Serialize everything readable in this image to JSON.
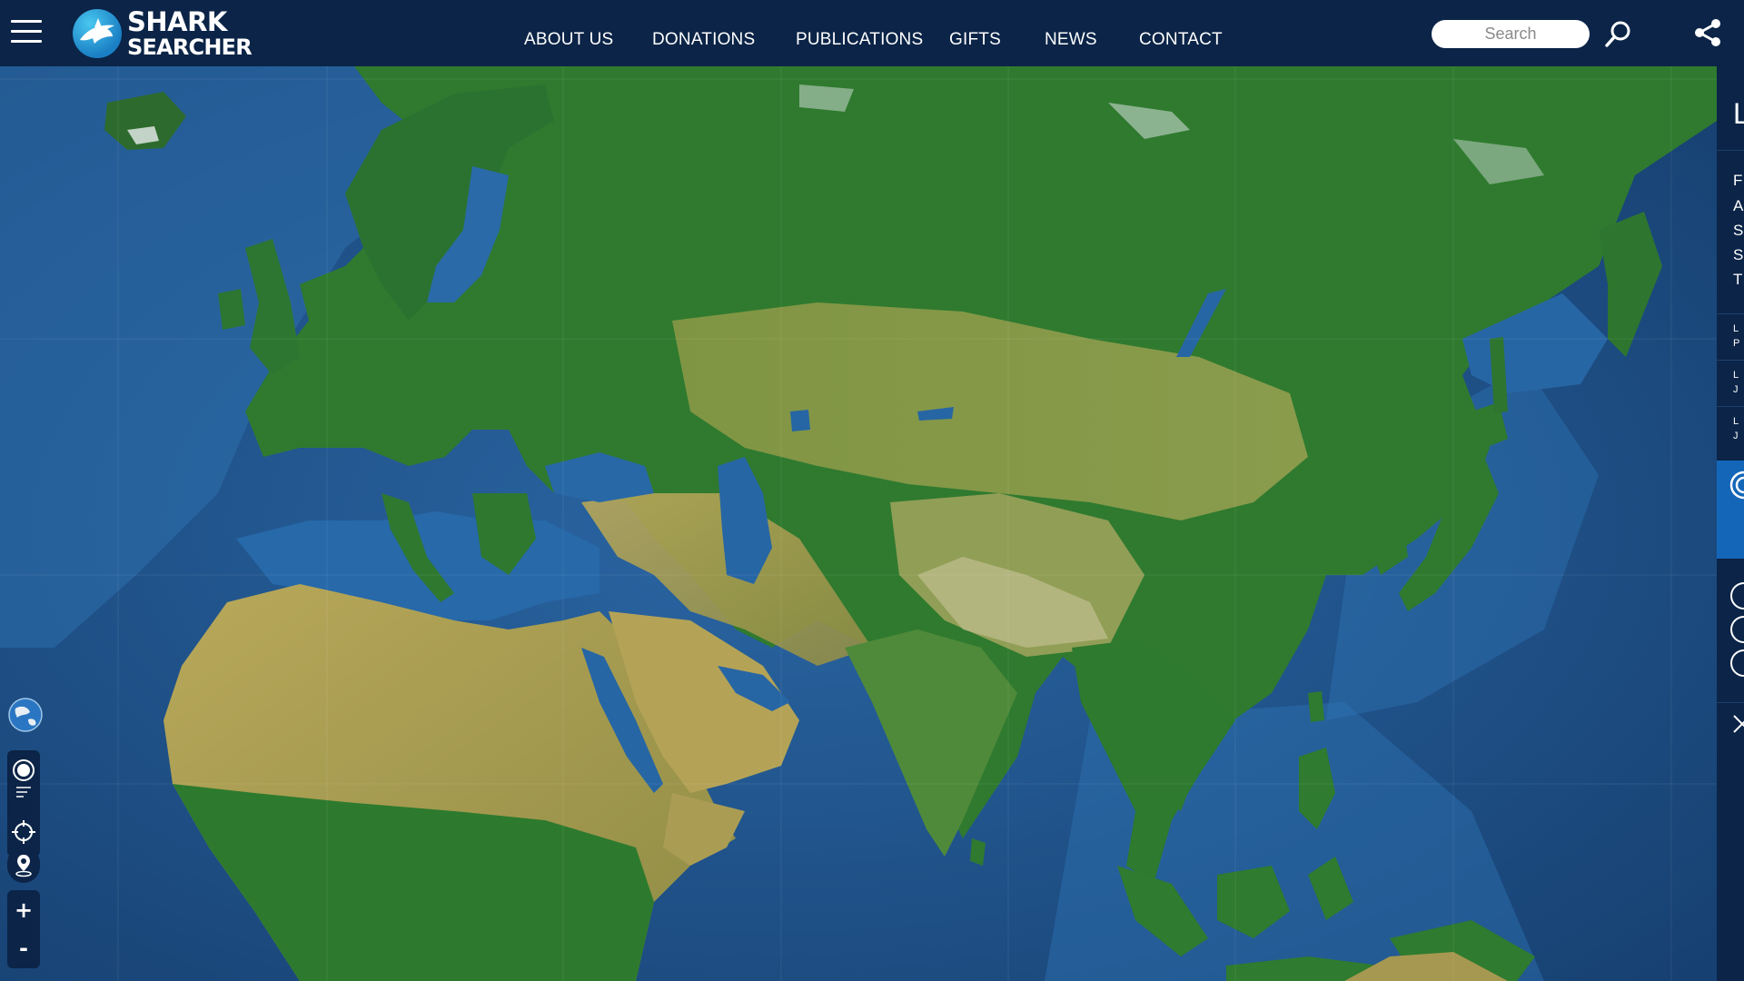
{
  "app": {
    "name_line1": "SHARK",
    "name_line2": "SEARCHER"
  },
  "nav": {
    "items": [
      {
        "label": "ABOUT US"
      },
      {
        "label": "DONATIONS"
      },
      {
        "label": "PUBLICATIONS"
      },
      {
        "label": "GIFTS"
      },
      {
        "label": "NEWS"
      },
      {
        "label": "CONTACT"
      }
    ]
  },
  "search": {
    "placeholder": "Search",
    "value": ""
  },
  "icons": {
    "menu": "hamburger-menu-icon",
    "search": "magnifier-icon",
    "share": "share-icon",
    "globe": "globe-icon",
    "layers": "layers-icon",
    "locate": "crosshair-icon",
    "pin": "location-pin-icon",
    "close": "close-x-icon"
  },
  "map_controls": {
    "zoom_in_label": "+",
    "zoom_out_label": "-"
  },
  "right_panel": {
    "header_glyph": "L",
    "list_initials": [
      "F",
      "A",
      "S",
      "S",
      "T"
    ],
    "recent": [
      {
        "line1": "L",
        "line2": "P"
      },
      {
        "line1": "L",
        "line2": "J"
      },
      {
        "line1": "L",
        "line2": "J"
      }
    ]
  },
  "colors": {
    "header_bg": "#0b2447",
    "accent_blue": "#1467b8",
    "ocean_deep": "#1a4a80",
    "ocean_shallow": "#2f78b8",
    "land_green": "#2c7a32",
    "land_desert": "#a9a052"
  }
}
